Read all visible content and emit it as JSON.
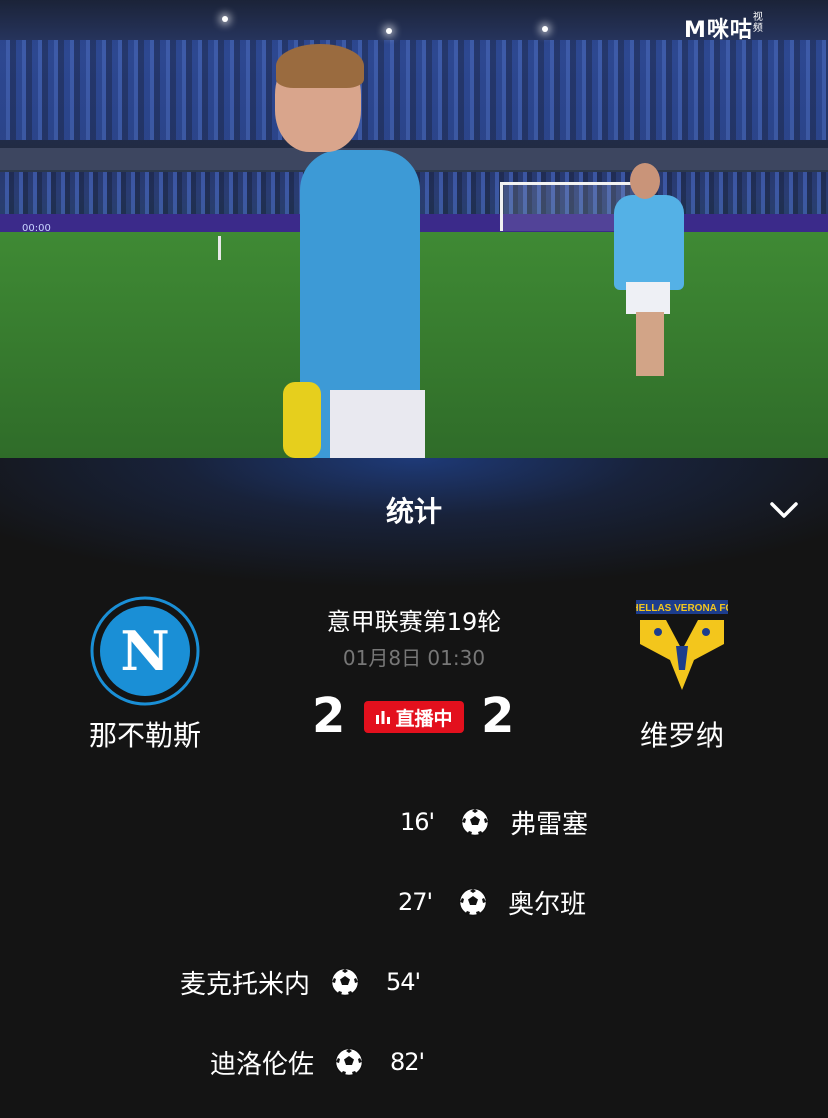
{
  "app": {
    "watermark_brand": "M咪咕",
    "watermark_sub": "视频"
  },
  "video": {
    "scoreboard_tag": "00:00"
  },
  "panel": {
    "title": "统计"
  },
  "match": {
    "competition": "意甲联赛第19轮",
    "datetime": "01月8日 01:30",
    "home_team": "那不勒斯",
    "away_team": "维罗纳",
    "home_score": "2",
    "away_score": "2",
    "status": "直播中",
    "away_logo_text": "HELLAS VERONA FC",
    "home_logo_letter": "N"
  },
  "events": [
    {
      "side": "away",
      "minute": "16'",
      "player": "弗雷塞",
      "type": "goal"
    },
    {
      "side": "away",
      "minute": "27'",
      "player": "奥尔班",
      "type": "goal"
    },
    {
      "side": "home",
      "minute": "54'",
      "player": "麦克托米内",
      "type": "goal"
    },
    {
      "side": "home",
      "minute": "82'",
      "player": "迪洛伦佐",
      "type": "goal"
    }
  ],
  "colors": {
    "live_red": "#e3101d",
    "napoli_blue": "#1a8fd6",
    "verona_yellow": "#f3c61c",
    "verona_blue": "#1d3d8c"
  }
}
